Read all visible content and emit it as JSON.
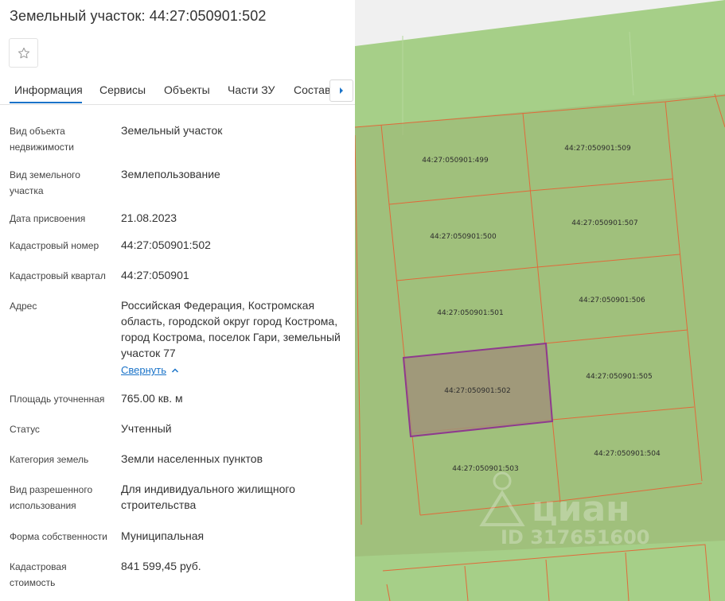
{
  "header": {
    "title": "Земельный участок: 44:27:050901:502",
    "favorite_icon": "star-outline-icon"
  },
  "tabs": {
    "items": [
      {
        "label": "Информация",
        "active": true
      },
      {
        "label": "Сервисы",
        "active": false
      },
      {
        "label": "Объекты",
        "active": false
      },
      {
        "label": "Части ЗУ",
        "active": false
      },
      {
        "label": "Состав",
        "active": false
      }
    ],
    "next_icon": "chevron-right-icon",
    "accent_color": "#1a73c8"
  },
  "info": {
    "rows": [
      {
        "label": "Вид объекта недвижимости",
        "value": "Земельный участок"
      },
      {
        "label": "Вид земельного участка",
        "value": "Землепользование"
      },
      {
        "label": "Дата присвоения",
        "value": "21.08.2023"
      },
      {
        "label": "Кадастровый номер",
        "value": "44:27:050901:502"
      },
      {
        "label": "Кадастровый квартал",
        "value": "44:27:050901"
      },
      {
        "label": "Адрес",
        "value": "Российская Федерация, Костромская область, городской округ город Кострома, город Кострома, поселок Гари, земельный участок 77"
      },
      {
        "label": "Площадь уточненная",
        "value": "765.00 кв. м"
      },
      {
        "label": "Статус",
        "value": "Учтенный"
      },
      {
        "label": "Категория земель",
        "value": "Земли населенных пунктов"
      },
      {
        "label": "Вид разрешенного использования",
        "value": "Для индивидуального жилищного строительства"
      },
      {
        "label": "Форма собственности",
        "value": "Муниципальная"
      },
      {
        "label": "Кадастровая стоимость",
        "value": "841 599,45 руб."
      }
    ],
    "collapse_label": "Свернуть"
  },
  "map": {
    "colors": {
      "land": "#a6cf88",
      "parcel_fill": "#9bb572",
      "border": "#e06a3a",
      "selected_fill": "#a0927a",
      "selected_border": "#8e3a8e"
    },
    "parcels": [
      {
        "label": "44:27:050901:499",
        "selected": false
      },
      {
        "label": "44:27:050901:509",
        "selected": false
      },
      {
        "label": "44:27:050901:500",
        "selected": false
      },
      {
        "label": "44:27:050901:507",
        "selected": false
      },
      {
        "label": "44:27:050901:501",
        "selected": false
      },
      {
        "label": "44:27:050901:506",
        "selected": false
      },
      {
        "label": "44:27:050901:502",
        "selected": true
      },
      {
        "label": "44:27:050901:505",
        "selected": false
      },
      {
        "label": "44:27:050901:503",
        "selected": false
      },
      {
        "label": "44:27:050901:504",
        "selected": false
      }
    ],
    "watermark": {
      "brand": "циан",
      "id_text": "ID 317651600"
    }
  }
}
